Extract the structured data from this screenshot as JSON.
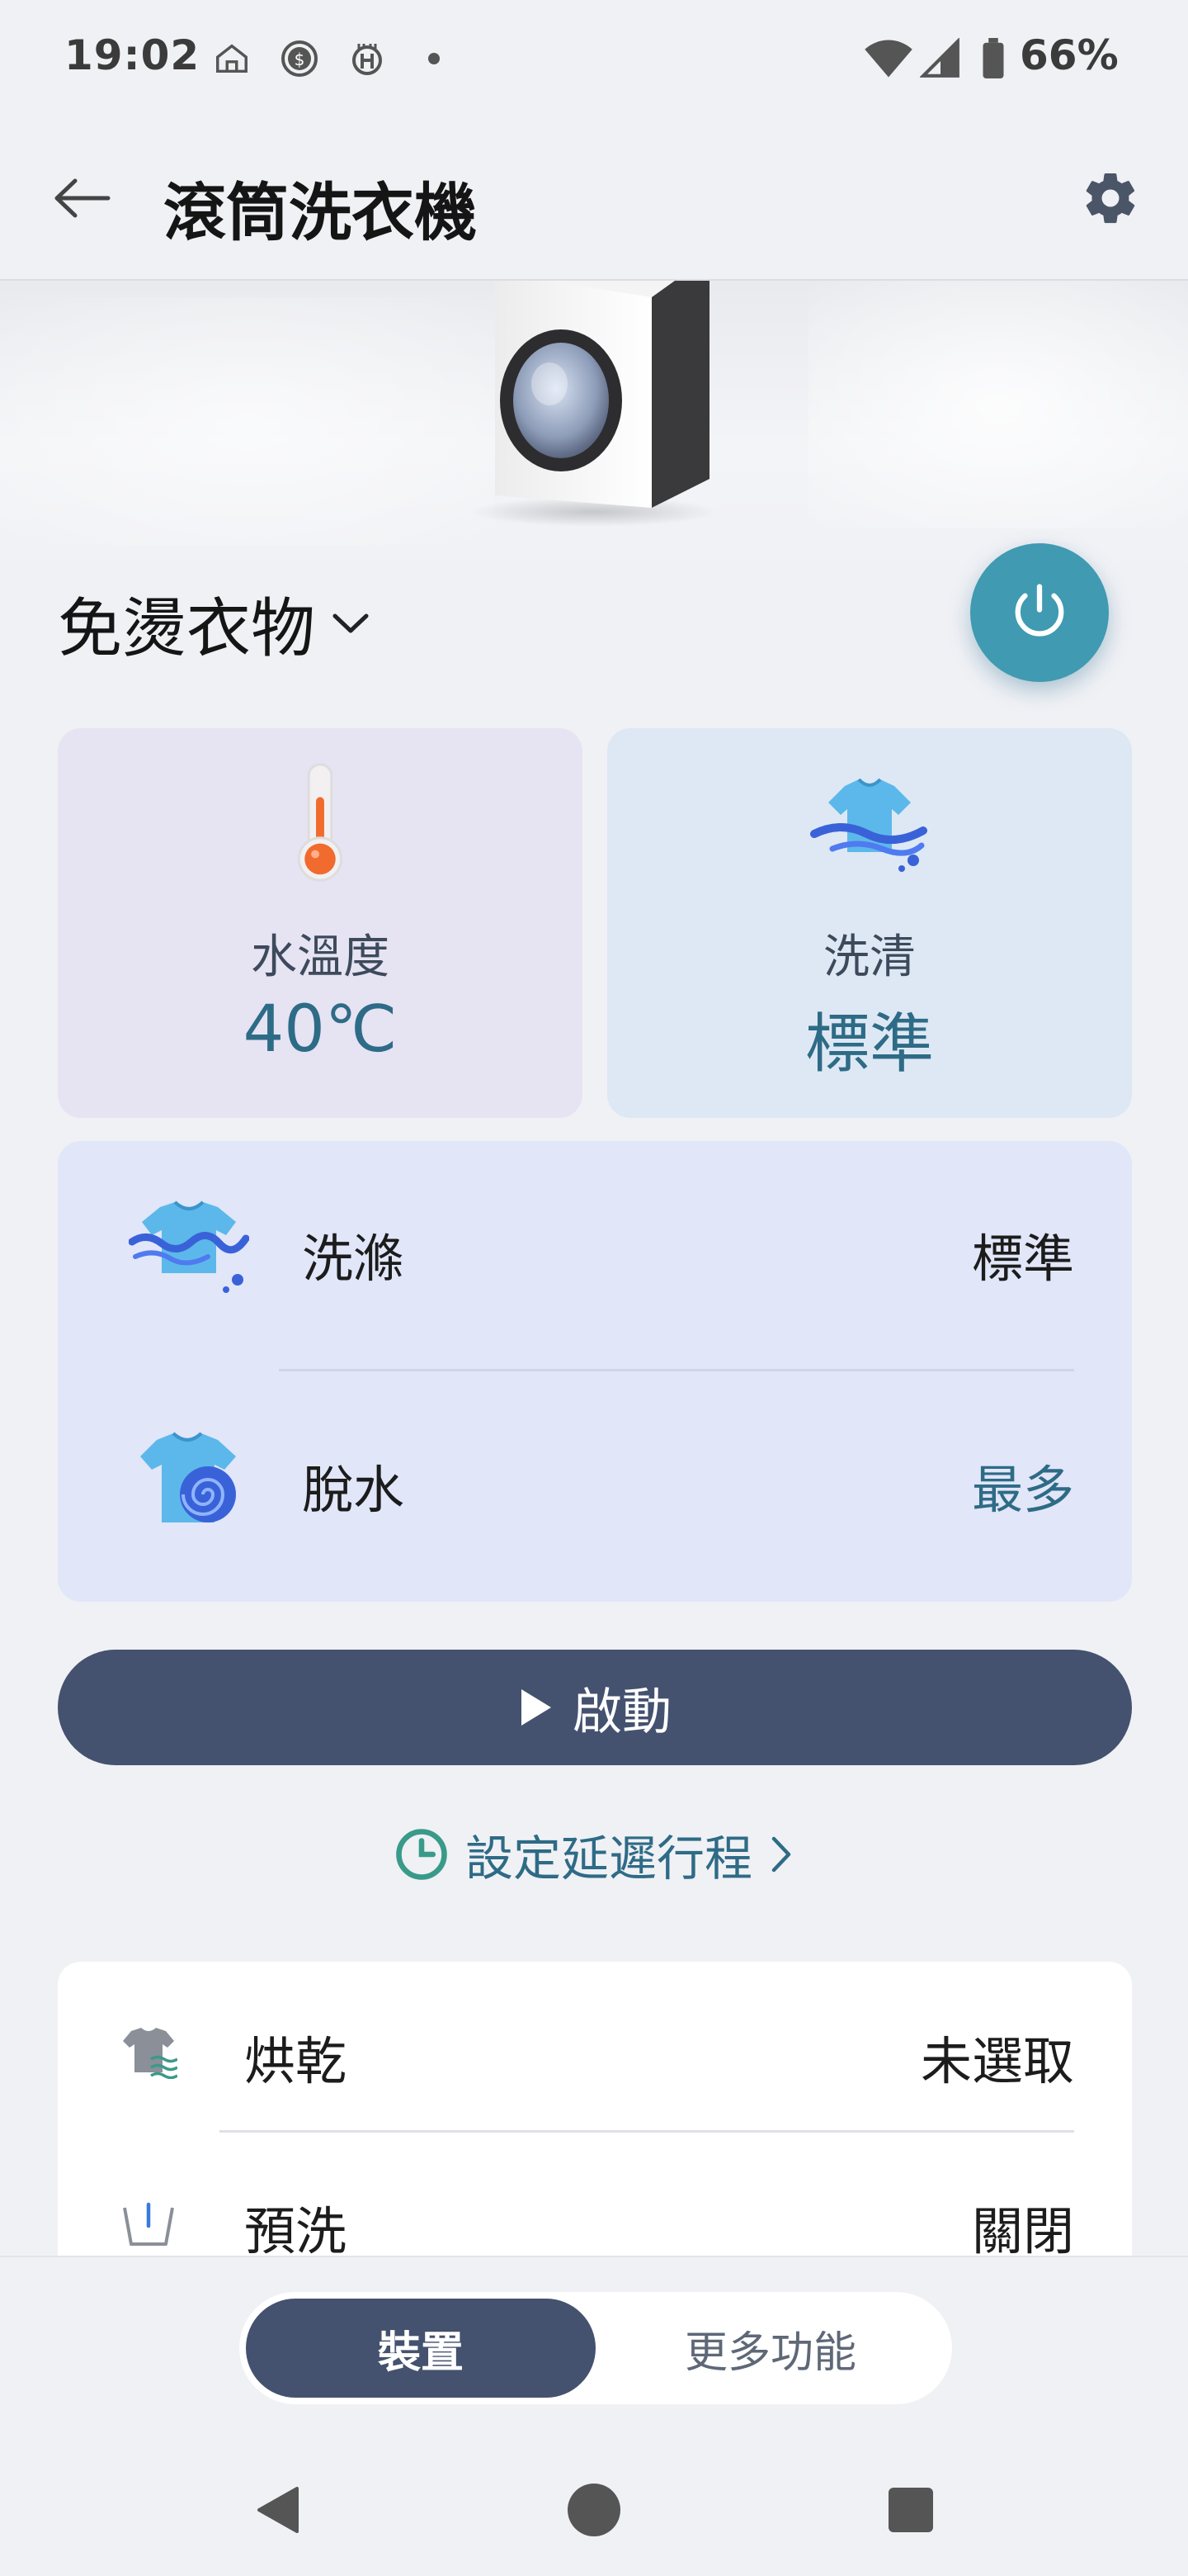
{
  "status_bar": {
    "time": "19:02",
    "battery": "66%",
    "icons": [
      "home-outline-icon",
      "dollar-coin-icon",
      "app-notification-icon",
      "dot-icon",
      "wifi-icon",
      "cell-signal-icon",
      "battery-icon"
    ]
  },
  "header": {
    "title": "滾筒洗衣機",
    "back_icon": "arrow-left-icon",
    "settings_icon": "gear-icon"
  },
  "program": {
    "name": "免燙衣物",
    "dropdown_icon": "chevron-down-icon",
    "power_icon": "power-icon"
  },
  "cards": {
    "temperature": {
      "label": "水溫度",
      "value": "40℃",
      "icon": "thermometer-icon"
    },
    "rinse": {
      "label": "洗清",
      "value": "標準",
      "icon": "shirt-wave-icon"
    }
  },
  "options": [
    {
      "label": "洗滌",
      "value": "標準",
      "icon": "shirt-water-icon"
    },
    {
      "label": "脫水",
      "value": "最多",
      "icon": "shirt-spin-icon"
    }
  ],
  "start_button": {
    "label": "啟動",
    "icon": "play-icon"
  },
  "delay": {
    "label": "設定延遲行程",
    "icon": "clock-icon",
    "chevron_icon": "chevron-right-icon"
  },
  "extras": [
    {
      "label": "烘乾",
      "value": "未選取",
      "icon": "shirt-dry-icon"
    },
    {
      "label": "預洗",
      "value": "關閉",
      "icon": "basin-icon"
    }
  ],
  "tabs": [
    {
      "label": "裝置",
      "active": true
    },
    {
      "label": "更多功能",
      "active": false
    }
  ],
  "nav": [
    "back-triangle-icon",
    "home-circle-icon",
    "recents-square-icon"
  ],
  "colors": {
    "accent": "#3f9ab2",
    "primary_dark": "#44526f",
    "value_text": "#2e6b86",
    "background": "#f0f1f5"
  }
}
